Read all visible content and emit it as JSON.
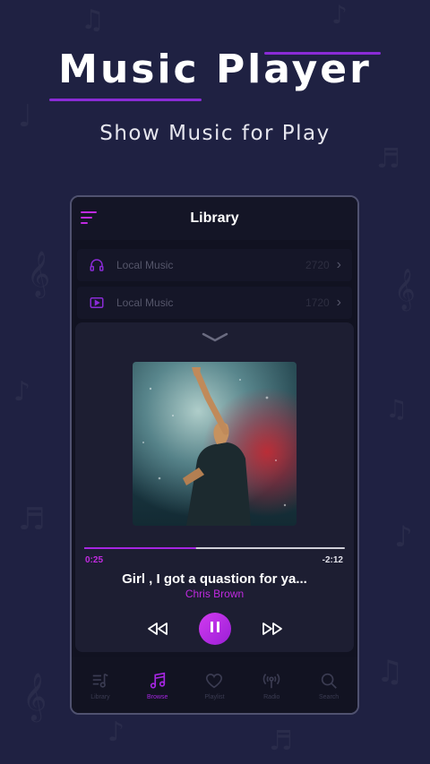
{
  "promo": {
    "title": "Music Player",
    "subtitle": "Show Music for Play"
  },
  "colors": {
    "background": "#1f2142",
    "accent": "#c02ae0",
    "accent_dark": "#9a1fd6"
  },
  "app": {
    "header": {
      "title": "Library",
      "menu_icon": "menu-icon"
    },
    "library_items": [
      {
        "label": "Local Music",
        "icon": "headphones-icon",
        "count": "2720"
      },
      {
        "label": "Local Music",
        "icon": "video-icon",
        "count": "1720"
      }
    ],
    "now_playing": {
      "collapse_icon": "chevron-down-icon",
      "progress": 0.43,
      "current_time": "0:25",
      "remaining_time": "-2:12",
      "song_title": "Girl , I got a quastion for ya...",
      "artist": "Chris Brown",
      "controls": {
        "previous_icon": "rewind-icon",
        "play_pause_icon": "pause-icon",
        "next_icon": "fast-forward-icon"
      }
    },
    "tabs": [
      {
        "label": "Library",
        "icon": "library-icon",
        "active": false
      },
      {
        "label": "Browse",
        "icon": "music-note-icon",
        "active": true
      },
      {
        "label": "Playlist",
        "icon": "heart-icon",
        "active": false
      },
      {
        "label": "Radio",
        "icon": "radio-icon",
        "active": false
      },
      {
        "label": "Search",
        "icon": "search-icon",
        "active": false
      }
    ]
  }
}
